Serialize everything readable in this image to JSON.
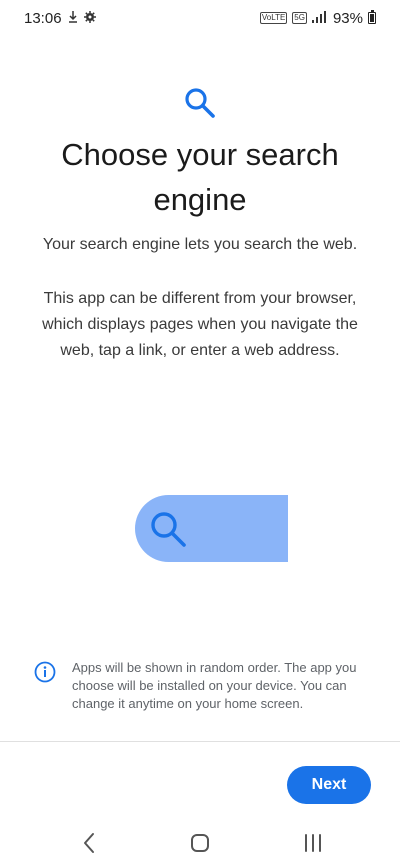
{
  "status_bar": {
    "time": "13:06",
    "network_tag_1": "VoLTE",
    "network_tag_2": "5G",
    "battery_percent": "93%",
    "icons": [
      "download-icon",
      "settings-gear-icon",
      "signal-icon",
      "battery-icon"
    ]
  },
  "main": {
    "title": "Choose your search engine",
    "subtitle": "Your search engine lets you search the web.",
    "description": "This app can be different from your browser, which displays pages when you navigate the web, tap a link, or enter a web address."
  },
  "info": {
    "text": "Apps will be shown in random order. The app you choose will be installed on your device. You can change it anytime on your home screen."
  },
  "footer": {
    "next_label": "Next"
  },
  "colors": {
    "accent": "#1a73e8",
    "illustration": "#8ab4f8"
  },
  "navigation": {
    "icons": [
      "back-icon",
      "home-icon",
      "recents-icon"
    ]
  }
}
